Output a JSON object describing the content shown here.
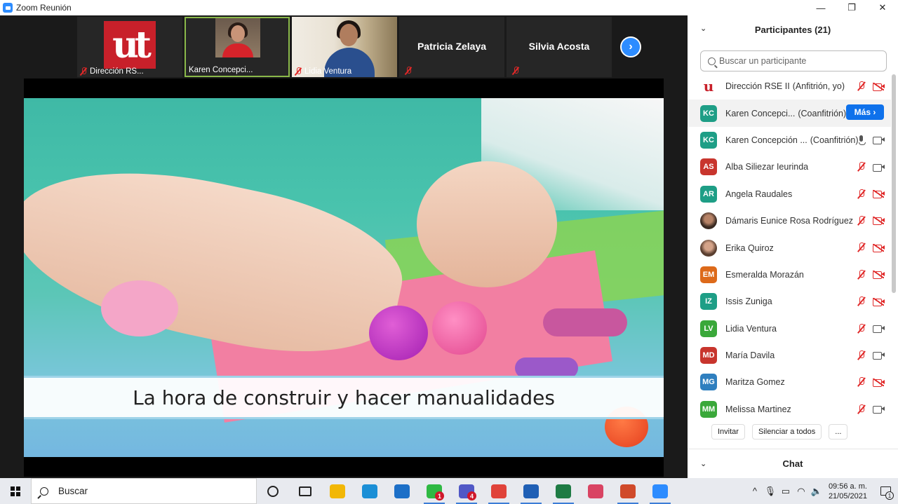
{
  "window": {
    "title": "Zoom Reunión",
    "min_icon": "minimize-icon",
    "max_icon": "maximize-icon",
    "close_icon": "close-icon"
  },
  "gallery": {
    "tiles": [
      {
        "name": "Dirección RS...",
        "logo_text": "ut",
        "type": "logo"
      },
      {
        "name": "Karen Concepci...",
        "type": "video",
        "active": true
      },
      {
        "name": "Lidia Ventura",
        "type": "video"
      },
      {
        "name": "Patricia Zelaya",
        "type": "name"
      },
      {
        "name": "Silvia Acosta",
        "type": "name"
      }
    ],
    "next_icon": "chevron-right-icon"
  },
  "shared_screen": {
    "banner_text": "La hora de construir y hacer manualidades"
  },
  "participants": {
    "title": "Participantes (21)",
    "search_placeholder": "Buscar un participante",
    "more_label": "Más ›",
    "list": [
      {
        "initials": "",
        "name": "Dirección RSE II",
        "role": "(Anfitrión, yo)",
        "color": "#ffffff",
        "mic": "off",
        "cam": "off"
      },
      {
        "initials": "KC",
        "name": "Karen Concepci...",
        "role": "(Coanfitrión)",
        "color": "#1e9e86",
        "mic": "none",
        "cam": "none"
      },
      {
        "initials": "KC",
        "name": "Karen Concepción ...",
        "role": "(Coanfitrión)",
        "color": "#1e9e86",
        "mic": "on",
        "cam": "on"
      },
      {
        "initials": "AS",
        "name": "Alba Siliezar Ieurinda",
        "role": "",
        "color": "#c8352d",
        "mic": "off",
        "cam": "on"
      },
      {
        "initials": "AR",
        "name": "Angela Raudales",
        "role": "",
        "color": "#1e9e86",
        "mic": "off",
        "cam": "off"
      },
      {
        "initials": "",
        "name": "Dámaris Eunice Rosa Rodríguez",
        "role": "",
        "color": "#3a2a22",
        "mic": "off",
        "cam": "off"
      },
      {
        "initials": "",
        "name": "Erika Quiroz",
        "role": "",
        "color": "#5a3f30",
        "mic": "off",
        "cam": "off"
      },
      {
        "initials": "EM",
        "name": "Esmeralda Morazán",
        "role": "",
        "color": "#dd6a1a",
        "mic": "off",
        "cam": "off"
      },
      {
        "initials": "IZ",
        "name": "Issis Zuniga",
        "role": "",
        "color": "#1e9e86",
        "mic": "off",
        "cam": "off"
      },
      {
        "initials": "LV",
        "name": "Lidia Ventura",
        "role": "",
        "color": "#3aa83a",
        "mic": "off",
        "cam": "on"
      },
      {
        "initials": "MD",
        "name": "María Davila",
        "role": "",
        "color": "#c8352d",
        "mic": "off",
        "cam": "on"
      },
      {
        "initials": "MG",
        "name": "Maritza Gomez",
        "role": "",
        "color": "#2f7fbf",
        "mic": "off",
        "cam": "off"
      },
      {
        "initials": "MM",
        "name": "Melissa Martinez",
        "role": "",
        "color": "#3aa83a",
        "mic": "off",
        "cam": "on"
      }
    ],
    "invite_label": "Invitar",
    "mute_all_label": "Silenciar a todos",
    "more_options_label": "..."
  },
  "chat": {
    "title": "Chat"
  },
  "taskbar": {
    "search_placeholder": "Buscar",
    "apps": [
      {
        "name": "cortana-icon",
        "color": "#222222",
        "badge": ""
      },
      {
        "name": "task-view-icon",
        "color": "#222222",
        "badge": ""
      },
      {
        "name": "file-explorer-icon",
        "color": "#f2b705",
        "badge": ""
      },
      {
        "name": "edge-icon",
        "color": "#1b8fd6",
        "badge": ""
      },
      {
        "name": "mail-icon",
        "color": "#1c6fc7",
        "badge": ""
      },
      {
        "name": "whatsapp-icon",
        "color": "#2fb943",
        "badge": "1"
      },
      {
        "name": "teams-icon",
        "color": "#5058c6",
        "badge": "4"
      },
      {
        "name": "chrome-icon",
        "color": "#e0433a",
        "badge": ""
      },
      {
        "name": "word-icon",
        "color": "#1f5fb5",
        "badge": ""
      },
      {
        "name": "excel-icon",
        "color": "#1e7b44",
        "badge": ""
      },
      {
        "name": "snip-icon",
        "color": "#d94463",
        "badge": ""
      },
      {
        "name": "powerpoint-icon",
        "color": "#d04a2a",
        "badge": ""
      },
      {
        "name": "zoom-icon",
        "color": "#2d8cff",
        "badge": ""
      }
    ],
    "time": "09:56 a. m.",
    "date": "21/05/2021",
    "notif_count": "1"
  }
}
